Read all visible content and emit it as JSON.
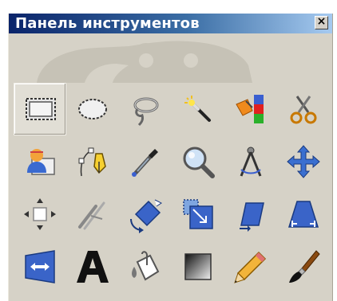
{
  "window": {
    "title": "Панель инструментов",
    "close_glyph": "×"
  },
  "tools": [
    {
      "icon": "rect-select-icon",
      "active": true
    },
    {
      "icon": "ellipse-select-icon"
    },
    {
      "icon": "lasso-select-icon"
    },
    {
      "icon": "fuzzy-select-icon"
    },
    {
      "icon": "color-select-icon"
    },
    {
      "icon": "scissors-select-icon"
    },
    {
      "icon": "foreground-select-icon"
    },
    {
      "icon": "paths-icon"
    },
    {
      "icon": "color-picker-icon"
    },
    {
      "icon": "zoom-icon"
    },
    {
      "icon": "measure-icon"
    },
    {
      "icon": "move-icon"
    },
    {
      "icon": "align-icon"
    },
    {
      "icon": "crop-icon"
    },
    {
      "icon": "rotate-icon"
    },
    {
      "icon": "scale-icon"
    },
    {
      "icon": "shear-icon"
    },
    {
      "icon": "perspective-icon"
    },
    {
      "icon": "flip-icon"
    },
    {
      "icon": "text-icon"
    },
    {
      "icon": "bucket-fill-icon"
    },
    {
      "icon": "blend-icon"
    },
    {
      "icon": "pencil-icon"
    },
    {
      "icon": "paintbrush-icon"
    }
  ],
  "colors": {
    "titlebar_start": "#0a246a",
    "titlebar_end": "#a6caf0",
    "panel_bg": "#d6d2c7"
  }
}
